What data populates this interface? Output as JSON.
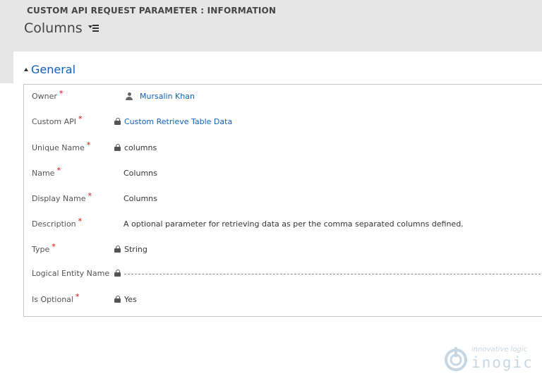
{
  "header": {
    "entity_title": "CUSTOM API REQUEST PARAMETER : INFORMATION",
    "record_name": "Columns"
  },
  "section": {
    "title": "General"
  },
  "fields": [
    {
      "label": "Owner",
      "required": true,
      "value": "Mursalin Khan",
      "icon": "user-icon",
      "is_link": true
    },
    {
      "label": "Custom API",
      "required": true,
      "value": "Custom Retrieve Table Data",
      "icon": "lock-icon",
      "is_link": true
    },
    {
      "label": "Unique Name",
      "required": true,
      "value": "columns",
      "icon": "lock-icon",
      "is_link": false
    },
    {
      "label": "Name",
      "required": true,
      "value": "Columns",
      "icon": "",
      "is_link": false
    },
    {
      "label": "Display Name",
      "required": true,
      "value": "Columns",
      "icon": "",
      "is_link": false
    },
    {
      "label": "Description",
      "required": true,
      "value": "A optional parameter for retrieving data as per the comma separated columns defined.",
      "icon": "",
      "is_link": false
    },
    {
      "label": "Type",
      "required": true,
      "value": "String",
      "icon": "lock-icon",
      "is_link": false
    },
    {
      "label": "Logical Entity Name",
      "required": false,
      "value": "",
      "icon": "lock-icon",
      "is_link": false
    },
    {
      "label": "Is Optional",
      "required": true,
      "value": "Yes",
      "icon": "lock-icon",
      "is_link": false
    }
  ],
  "required_marker": "*",
  "watermark": {
    "tagline": "innovative logic",
    "brand": "inogic"
  },
  "colors": {
    "link": "#1160b7",
    "required": "#e00000",
    "header_bg": "#e6e6e6"
  }
}
